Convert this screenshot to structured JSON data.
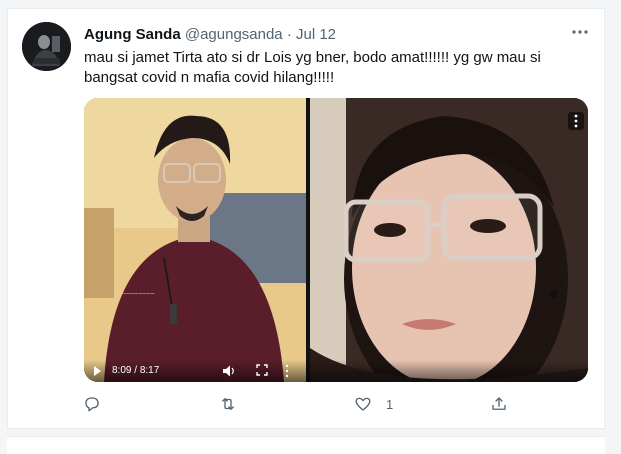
{
  "tweet": {
    "author_name": "Agung Sanda",
    "handle": "@agungsanda",
    "separator": "·",
    "date": "Jul 12",
    "text": "mau si jamet Tirta ato si dr Lois yg bner, bodo amat!!!!!! yg gw mau si bangsat covid n mafia covid hilang!!!!!",
    "more_icon": "more-horizontal-icon"
  },
  "video": {
    "current_time": "8:09",
    "time_separator": " / ",
    "duration": "8:17",
    "progress": 0.984
  },
  "actions": {
    "reply_icon": "reply-icon",
    "retweet_icon": "retweet-icon",
    "like_icon": "heart-icon",
    "like_count": "1",
    "share_icon": "share-icon"
  },
  "colors": {
    "text_primary": "#0f1419",
    "text_secondary": "#536471",
    "border": "#e6ecf0",
    "page_background": "#f4f5f6"
  }
}
